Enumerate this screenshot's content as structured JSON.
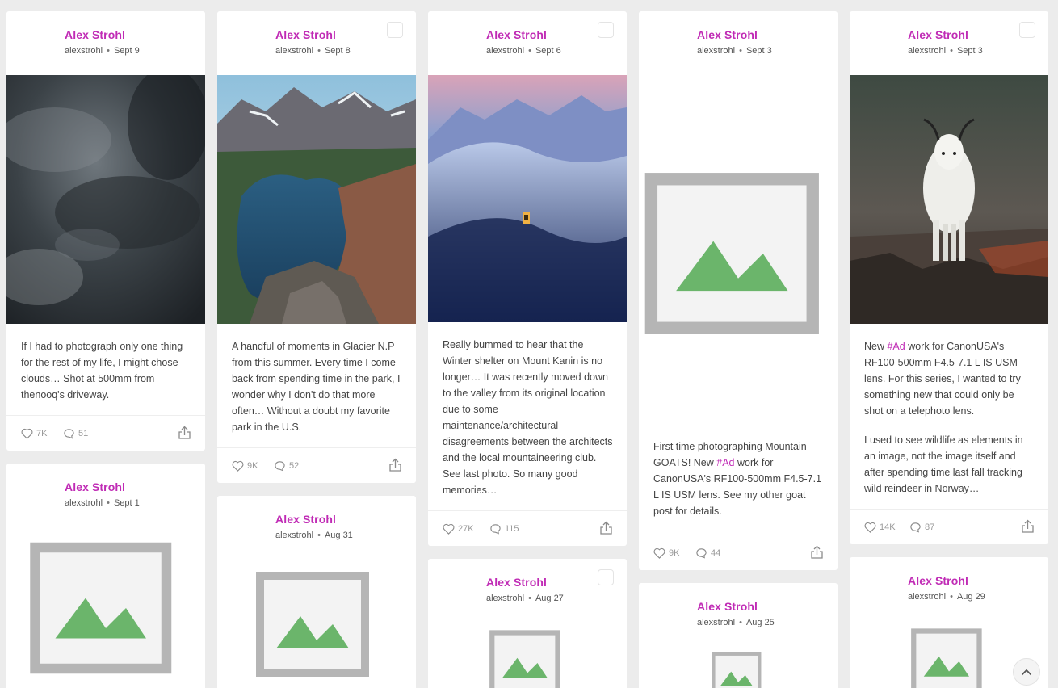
{
  "cards": [
    {
      "author": "Alex Strohl",
      "handle": "alexstrohl",
      "date": "Sept 9",
      "text1": "If I had to photograph only one thing for the rest of my life, I might chose clouds… Shot at 500mm from thenooq's driveway.",
      "likes": "7K",
      "comments": "51"
    },
    {
      "author": "Alex Strohl",
      "handle": "alexstrohl",
      "date": "Sept 8",
      "text1": "A handful of moments in Glacier N.P from this summer. Every time I come back from spending time in the park, I wonder why I don't do that more often… Without a doubt my favorite park in the U.S.",
      "likes": "9K",
      "comments": "52"
    },
    {
      "author": "Alex Strohl",
      "handle": "alexstrohl",
      "date": "Sept 6",
      "text1": "Really bummed to hear that the Winter shelter on Mount Kanin is no longer… It was recently moved down to the valley from its original location due to some maintenance/architectural disagreements between the architects and the local mountaineering club. See last photo. So many good memories…",
      "likes": "27K",
      "comments": "115"
    },
    {
      "author": "Alex Strohl",
      "handle": "alexstrohl",
      "date": "Sept 3",
      "text_a": "First time photographing Mountain GOATS! New ",
      "tag": "#Ad",
      "text_b": " work for CanonUSA's RF100-500mm F4.5-7.1 L IS USM lens. See my other goat post for details.",
      "likes": "9K",
      "comments": "44"
    },
    {
      "author": "Alex Strohl",
      "handle": "alexstrohl",
      "date": "Sept 3",
      "text_a": "New ",
      "tag": "#Ad",
      "text_b": " work for CanonUSA's RF100-500mm F4.5-7.1 L IS USM lens. For this series, I wanted to try something new that could only be shot on a telephoto lens.",
      "text2": "I used to see wildlife as elements in an image, not the image itself and after spending time last fall tracking wild reindeer in Norway…",
      "likes": "14K",
      "comments": "87"
    },
    {
      "author": "Alex Strohl",
      "handle": "alexstrohl",
      "date": "Sept 1"
    },
    {
      "author": "Alex Strohl",
      "handle": "alexstrohl",
      "date": "Aug 31"
    },
    {
      "author": "Alex Strohl",
      "handle": "alexstrohl",
      "date": "Aug 27"
    },
    {
      "author": "Alex Strohl",
      "handle": "alexstrohl",
      "date": "Aug 25"
    },
    {
      "author": "Alex Strohl",
      "handle": "alexstrohl",
      "date": "Aug 29"
    }
  ],
  "icons": {
    "like": "heart-icon",
    "comment": "comment-bubble-icon",
    "share": "share-icon",
    "top": "chevron-up-icon"
  }
}
